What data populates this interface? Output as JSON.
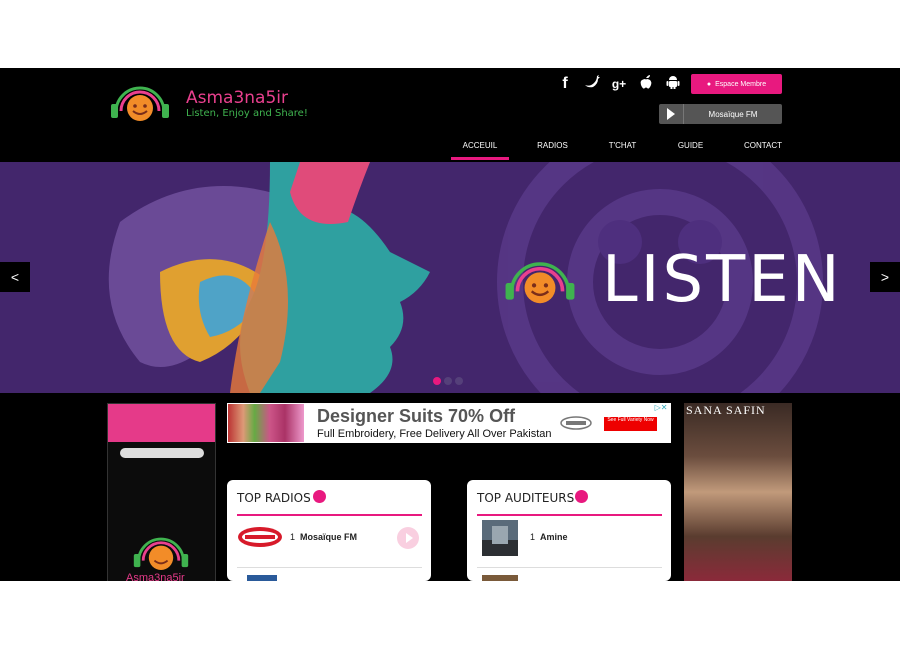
{
  "brand": {
    "name": "Asma3na5ir",
    "tagline": "Listen, Enjoy and Share!"
  },
  "header": {
    "socials": [
      "f",
      "t",
      "g+",
      "apple",
      "android"
    ],
    "member_button": "Espace Membre",
    "player": {
      "station": "Mosaïque FM"
    }
  },
  "nav": [
    "ACCEUIL",
    "RADIOS",
    "T'CHAT",
    "GUIDE",
    "CONTACT"
  ],
  "hero": {
    "text": "LISTEN",
    "prev": "<",
    "next": ">",
    "slide_count": 3,
    "active_slide": 1
  },
  "ad_top": {
    "title": "Designer Suits 70% Off",
    "subtitle": "Full Embroidery, Free Delivery All Over Pakistan",
    "cta": "See Full Variety Now"
  },
  "ad_right": {
    "label": "SANA SAFIN"
  },
  "top_radios": {
    "title": "TOP RADIOS",
    "items": [
      {
        "rank": "1",
        "name": "Mosaïque FM",
        "logo_text": "mosaïque"
      }
    ]
  },
  "top_auditeurs": {
    "title": "TOP AUDITEURS",
    "items": [
      {
        "rank": "1",
        "name": "Amine"
      }
    ]
  },
  "phone": {
    "app_name": "Asma3na5ir"
  },
  "colors": {
    "accent": "#e8197f",
    "brand_green": "#3fb34f",
    "hero_bg": "#43266c"
  }
}
